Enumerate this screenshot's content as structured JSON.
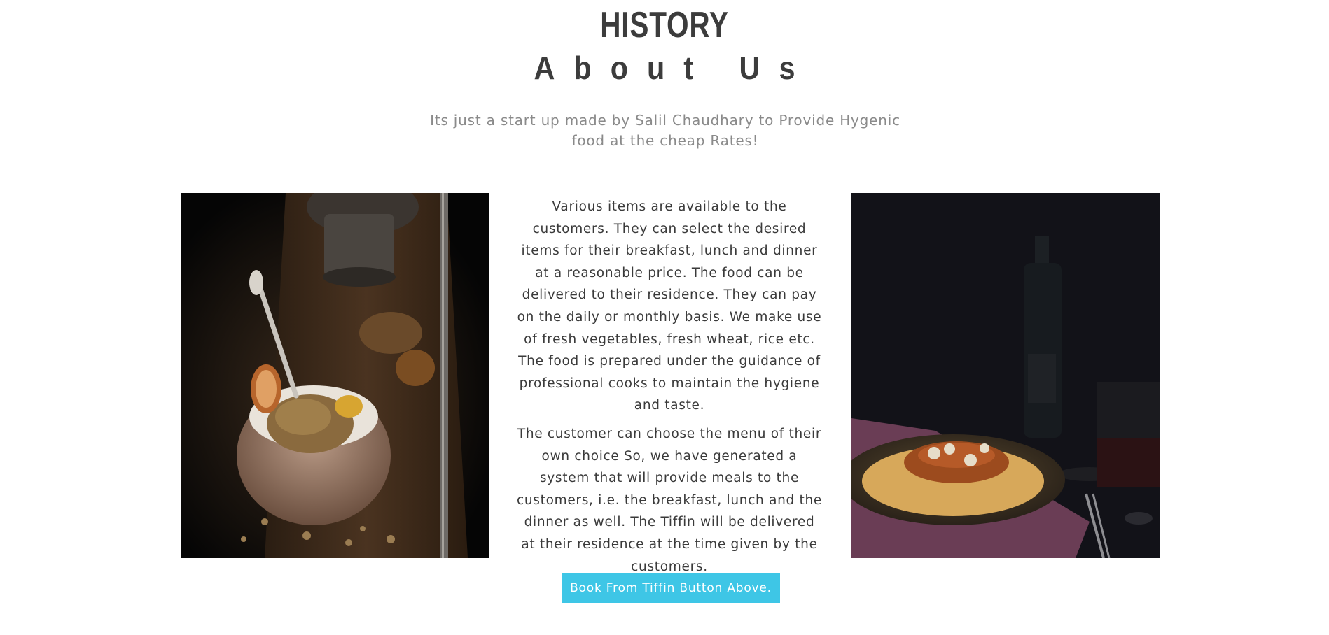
{
  "section": {
    "heading": "HISTORY",
    "subheading": "About Us",
    "tagline": "Its just a start up made by Salil Chaudhary to Provide Hygenic food at the cheap Rates!"
  },
  "content": {
    "paragraph_1": "Various items are available to the customers. They can select the desired items for their breakfast, lunch and dinner at a reasonable price. The food can be delivered to their residence. They can pay on the daily or monthly basis. We make use of fresh vegetables, fresh wheat, rice etc. The food is prepared under the guidance of professional cooks to maintain the hygiene and taste.",
    "paragraph_2": "The customer can choose the menu of their own choice So, we have generated a system that will provide meals to the customers, i.e. the breakfast, lunch and the dinner as well. The Tiffin will be delivered at their residence at the time given by the customers."
  },
  "images": {
    "left": "granola-bowl-photo",
    "right": "spaghetti-dinner-photo"
  },
  "cta": {
    "label": "Book From Tiffin Button Above."
  },
  "colors": {
    "accent": "#3ec6e6",
    "heading": "#3c3c3c",
    "tagline": "#8a8a8a"
  }
}
